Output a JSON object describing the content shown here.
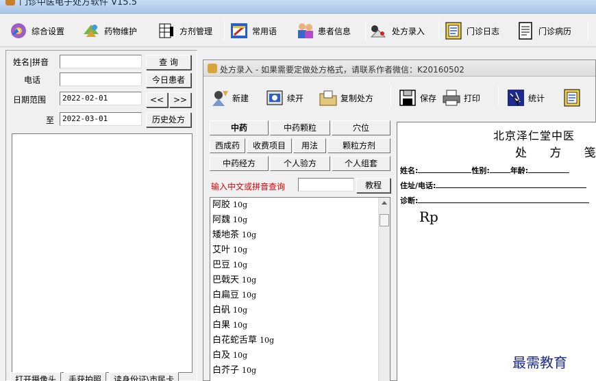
{
  "window": {
    "title": "门诊中医电子处方软件 V15.5"
  },
  "toolbar": {
    "items": [
      {
        "label": "综合设置",
        "icon": "settings-disc-icon"
      },
      {
        "label": "药物维护",
        "icon": "herb-icon"
      },
      {
        "label": "方剂管理",
        "icon": "document-grid-icon"
      },
      {
        "label": "常用语",
        "icon": "notebook-icon"
      },
      {
        "label": "患者信息",
        "icon": "patients-icon"
      },
      {
        "label": "处方录入",
        "icon": "prescription-entry-icon"
      },
      {
        "label": "门诊日志",
        "icon": "log-book-icon"
      },
      {
        "label": "门诊病历",
        "icon": "record-page-icon"
      }
    ]
  },
  "search": {
    "name_label": "姓名|拼音",
    "phone_label": "电话",
    "date_range_label": "日期范围",
    "to_label": "至",
    "name_value": "",
    "phone_value": "",
    "date_from": "2022-02-01",
    "date_to": "2022-03-01",
    "query_button": "查  询",
    "today_button": "今日患者",
    "prev_button": "<<",
    "next_button": ">>",
    "history_button": "历史处方"
  },
  "bottom_buttons": [
    "打开摄像头",
    "手获拍照",
    "读身份证\\市民卡"
  ],
  "child": {
    "title": "处方录入 - 如果需要定做处方格式，请联系作者微信：K20160502",
    "toolbar": [
      "新建",
      "续开",
      "复制处方",
      "保存",
      "打印",
      "统计"
    ]
  },
  "categories": {
    "row1": [
      "中药",
      "中药颗粒",
      "穴位"
    ],
    "row2": [
      "西成药",
      "收费项目",
      "用法",
      "颗粒方剂"
    ],
    "row3": [
      "中药经方",
      "个人验方",
      "个人组套"
    ]
  },
  "filter": {
    "label": "输入中文或拼音查询",
    "value": "",
    "tutorial_button": "教程",
    "label_color": "#e00000"
  },
  "drugs": [
    {
      "name": "阿胶",
      "dose": "10g"
    },
    {
      "name": "阿魏",
      "dose": "10g"
    },
    {
      "name": "矮地茶",
      "dose": "10g"
    },
    {
      "name": "艾叶",
      "dose": "10g"
    },
    {
      "name": "巴豆",
      "dose": "10g"
    },
    {
      "name": "巴戟天",
      "dose": "10g"
    },
    {
      "name": "白扁豆",
      "dose": "10g"
    },
    {
      "name": "白矾",
      "dose": "10g"
    },
    {
      "name": "白果",
      "dose": "10g"
    },
    {
      "name": "白花蛇舌草",
      "dose": "10g"
    },
    {
      "name": "白及",
      "dose": "10g"
    },
    {
      "name": "白芥子",
      "dose": "10g"
    }
  ],
  "prescription": {
    "hospital": "北京泽仁堂中医",
    "title": "处 方 笺",
    "name_label": "姓名:",
    "gender_label": "性别:",
    "age_label": "年龄:",
    "address_label": "住址/电话:",
    "diagnosis_label": "诊断:",
    "rp": "Rp"
  },
  "watermark": "最需教育"
}
